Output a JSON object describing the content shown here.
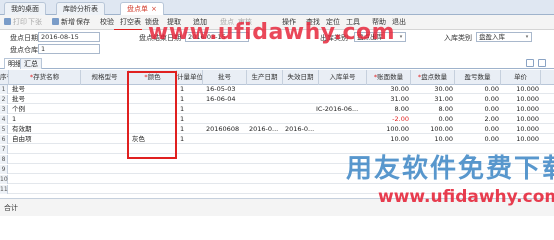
{
  "tabs": [
    {
      "label": "我的桌面"
    },
    {
      "label": "库龄分析表"
    },
    {
      "label": "盘点单"
    }
  ],
  "tab_close_glyph": "×",
  "toolbar": {
    "items": [
      "打印",
      "下张",
      "新增",
      "保存",
      "校验",
      "打空表",
      "锁盘",
      "提取",
      "追加",
      "盘点",
      "审核",
      "操作",
      "查找",
      "定位",
      "工具",
      "帮助",
      "退出"
    ],
    "highlighted": "打空表"
  },
  "form": {
    "date_label": "盘点日期",
    "date_value": "2016-08-15",
    "end_date_label": "盘点结束日期",
    "end_date_value": "2016-08-15",
    "business_label": "出库类别",
    "business_value": "盘点出库",
    "in_type_label": "入库类别",
    "in_type_value": "盘盈入库",
    "warehouse_label": "盘点仓库",
    "warehouse_value": "1",
    "dropdown_glyph": "▾"
  },
  "subtabs": [
    "明细",
    "汇总"
  ],
  "grid": {
    "headers": [
      "序号",
      "存货名称",
      "规格型号",
      "颜色",
      "计量单位",
      "批号",
      "生产日期",
      "失效日期",
      "入库单号",
      "账面数量",
      "盘点数量",
      "盈亏数量",
      "单价"
    ],
    "required_marks": [
      "存货名称",
      "颜色",
      "账面数量",
      "盘点数量"
    ],
    "rows": [
      {
        "no": "1",
        "name": "批号",
        "spec": "",
        "color": "",
        "unit": "1",
        "batch": "16-05-03",
        "mfg": "",
        "exp": "",
        "inbill": "",
        "book": "30.00",
        "count": "30.00",
        "diff": "0.00",
        "price": "10.000"
      },
      {
        "no": "2",
        "name": "批号",
        "spec": "",
        "color": "",
        "unit": "1",
        "batch": "16-06-04",
        "mfg": "",
        "exp": "",
        "inbill": "",
        "book": "31.00",
        "count": "31.00",
        "diff": "0.00",
        "price": "10.000"
      },
      {
        "no": "3",
        "name": "个例",
        "spec": "",
        "color": "",
        "unit": "1",
        "batch": "",
        "mfg": "",
        "exp": "",
        "inbill": "IC-2016-06...",
        "book": "8.00",
        "count": "8.00",
        "diff": "0.00",
        "price": "10.000"
      },
      {
        "no": "4",
        "name": "1",
        "spec": "",
        "color": "",
        "unit": "1",
        "batch": "",
        "mfg": "",
        "exp": "",
        "inbill": "",
        "book": "-2.00",
        "count": "0.00",
        "diff": "2.00",
        "price": "10.000",
        "neg": true
      },
      {
        "no": "5",
        "name": "有效期",
        "spec": "",
        "color": "",
        "unit": "1",
        "batch": "20160608",
        "mfg": "2016-0...",
        "exp": "2016-0...",
        "inbill": "",
        "book": "100.00",
        "count": "100.00",
        "diff": "0.00",
        "price": "10.000"
      },
      {
        "no": "6",
        "name": "自由项",
        "spec": "",
        "color": "灰色",
        "unit": "1",
        "batch": "",
        "mfg": "",
        "exp": "",
        "inbill": "",
        "book": "10.00",
        "count": "10.00",
        "diff": "0.00",
        "price": "10.000"
      }
    ],
    "empty_row_numbers": [
      "7",
      "8",
      "9",
      "10",
      "11"
    ]
  },
  "footer": {
    "label": "合计"
  },
  "watermarks": {
    "url_top": "www.ufidawhy.com",
    "cn": "用友软件免费下载",
    "url_bottom": "www.ufidawhy.com"
  },
  "colors": {
    "highlight_box": "#e02020",
    "tab_bar": "#dfe7f2",
    "grid_header": "#e9eef5",
    "negative": "#e02020"
  }
}
